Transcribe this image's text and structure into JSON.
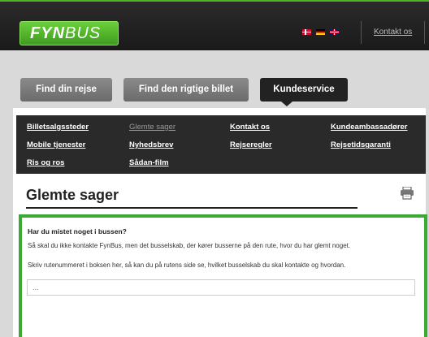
{
  "header": {
    "logo_bold": "FYN",
    "logo_thin": "BUS",
    "flags": [
      "dk-flag-icon",
      "de-flag-icon",
      "uk-flag-icon"
    ],
    "contact_link": "Kontakt os"
  },
  "tabs": [
    {
      "label": "Find din rejse",
      "active": false
    },
    {
      "label": "Find den rigtige billet",
      "active": false
    },
    {
      "label": "Kundeservice",
      "active": true
    }
  ],
  "submenu": {
    "items": [
      {
        "label": "Billetsalgssteder",
        "active": false
      },
      {
        "label": "Glemte sager",
        "active": true
      },
      {
        "label": "Kontakt os",
        "active": false
      },
      {
        "label": "Kundeambassadører",
        "active": false
      },
      {
        "label": "Mobile tjenester",
        "active": false
      },
      {
        "label": "Nyhedsbrev",
        "active": false
      },
      {
        "label": "Rejseregler",
        "active": false
      },
      {
        "label": "Rejsetidsgaranti",
        "active": false
      },
      {
        "label": "Ris og ros",
        "active": false
      },
      {
        "label": "Sådan-film",
        "active": false
      }
    ]
  },
  "page": {
    "title": "Glemte sager",
    "print_icon": "print-icon"
  },
  "form": {
    "question": "Har du mistet noget i bussen?",
    "line1": "Så skal du ikke kontakte FynBus, men det busselskab, der kører busserne på den rute, hvor du har glemt noget.",
    "line2": "Skriv rutenummeret i boksen her, så kan du på rutens side se, hvilket busselskab du skal kontakte og hvordan.",
    "input_placeholder": "..."
  },
  "colors": {
    "brand_green": "#3aa935",
    "header_dark": "#1a1a1a",
    "submenu_bg": "#2a2a2a"
  }
}
